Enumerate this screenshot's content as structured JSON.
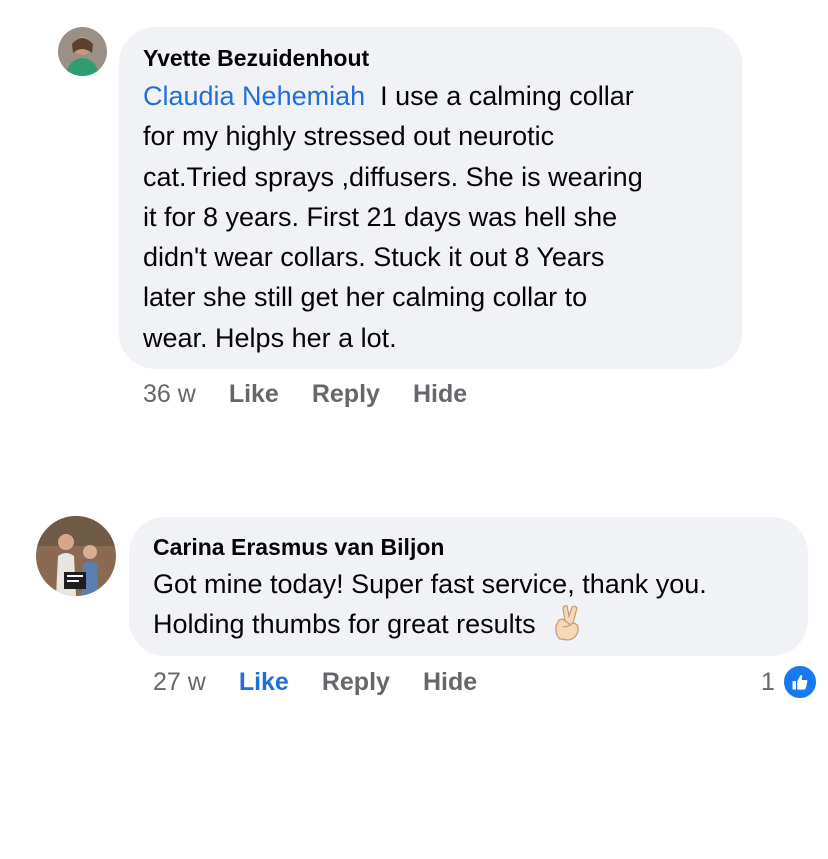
{
  "comments": [
    {
      "author": "Yvette Bezuidenhout",
      "mention": "Claudia Nehemiah",
      "text_lines": [
        "I use a calming collar",
        "for  my highly stressed out neurotic",
        "cat.Tried sprays ,diffusers. She  is wearing",
        "it for  8 years. First 21 days was hell she",
        "didn't wear collars. Stuck it out  8 Years",
        "later she still get her calming collar to",
        "wear. Helps her a lot."
      ],
      "time": "36 w",
      "actions": {
        "like": "Like",
        "reply": "Reply",
        "hide": "Hide"
      }
    },
    {
      "author": "Carina Erasmus van Biljon",
      "text_lines": [
        "Got mine today! Super fast service, thank you.",
        "Holding thumbs for great results"
      ],
      "emoji": "crossed-fingers",
      "time": "27 w",
      "actions": {
        "like": "Like",
        "reply": "Reply",
        "hide": "Hide"
      },
      "liked": true,
      "reaction_count": "1",
      "reaction_icon": "like-icon"
    }
  ],
  "colors": {
    "bubble": "#f0f2f5",
    "mention": "#216fdb",
    "like_active": "#216fdb",
    "meta": "#65676b",
    "like_badge": "#1877f2"
  }
}
